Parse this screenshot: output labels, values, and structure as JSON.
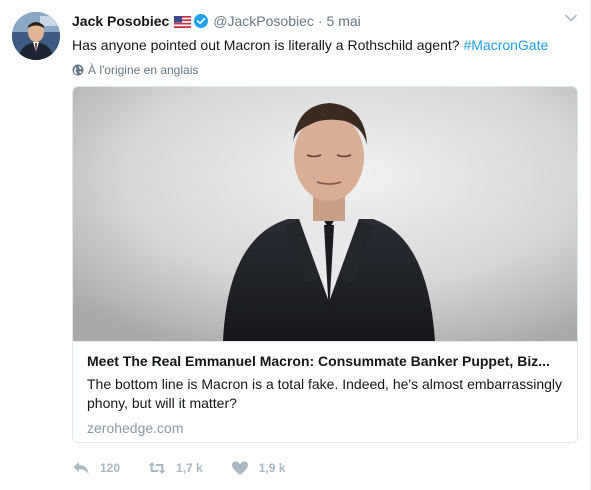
{
  "tweet": {
    "author_name": "Jack Posobiec",
    "handle": "@JackPosobiec",
    "separator": "·",
    "time": "5 mai",
    "text": "Has anyone pointed out Macron is literally a Rothschild agent? ",
    "hashtag": "#MacronGate",
    "translate_note": "À l'origine en anglais"
  },
  "card": {
    "title": "Meet The Real Emmanuel Macron: Consummate Banker Puppet, Biz...",
    "description": "The bottom line is Macron is a total fake. Indeed, he's almost embarrassingly phony, but will it matter?",
    "domain": "zerohedge.com"
  },
  "actions": {
    "replies": "120",
    "retweets": "1,7 k",
    "likes": "1,9 k"
  },
  "icons": {
    "flag": "us-flag-icon",
    "verified": "verified-badge-icon",
    "caret": "chevron-down-icon",
    "globe": "globe-icon",
    "reply": "reply-icon",
    "retweet": "retweet-icon",
    "like": "heart-icon"
  },
  "colors": {
    "hashtag": "#1da1f2",
    "verified": "#1da1f2",
    "action_icon": "#aab8c2",
    "secondary_text": "#657786"
  }
}
